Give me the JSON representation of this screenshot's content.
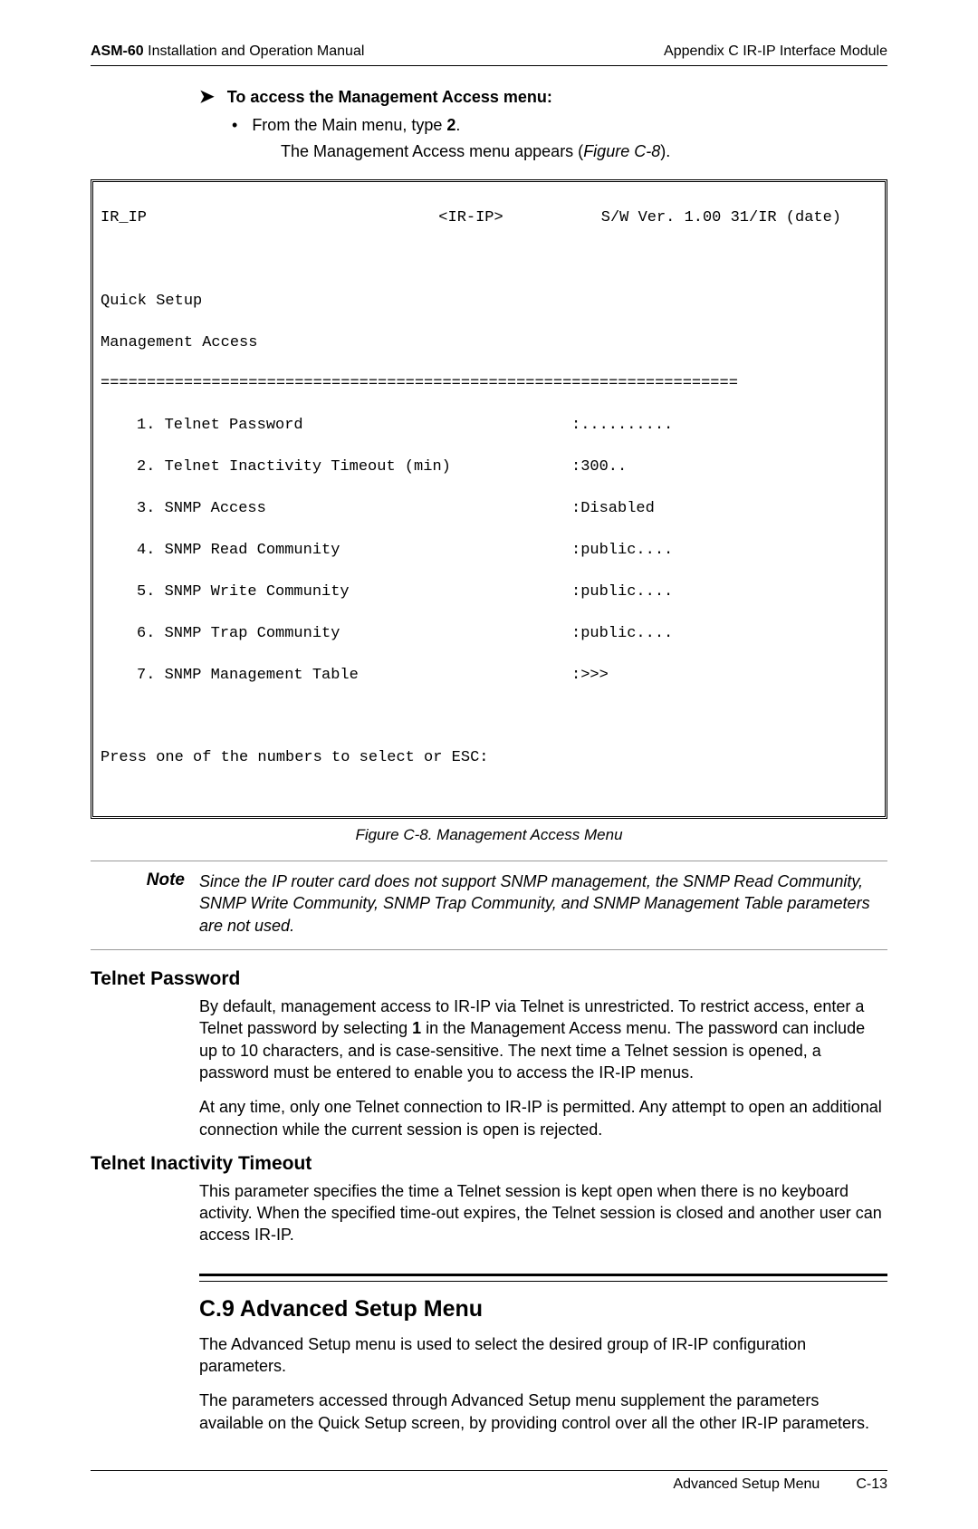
{
  "header": {
    "product": "ASM-60",
    "manual": "Installation and Operation Manual",
    "appendix": "Appendix C  IR-IP Interface Module"
  },
  "proc": {
    "title": "To access the Management Access menu:",
    "bullet_prefix": "From the Main menu, type ",
    "bullet_bold": "2",
    "bullet_suffix": ".",
    "result_prefix": "The Management Access menu appears (",
    "result_ref": "Figure C-8",
    "result_suffix": ")."
  },
  "terminal": {
    "hdr_left": "IR_IP",
    "hdr_center": "<IR-IP>",
    "hdr_right": "S/W Ver. 1.00 31/IR (date)",
    "line1": "Quick Setup",
    "line2": "Management Access",
    "divider": "=====================================================================",
    "rows": [
      {
        "label": "1. Telnet Password",
        "val": ":.........."
      },
      {
        "label": "2. Telnet Inactivity Timeout (min)",
        "val": ":300.."
      },
      {
        "label": "3. SNMP Access",
        "val": ":Disabled"
      },
      {
        "label": "4. SNMP Read Community",
        "val": ":public...."
      },
      {
        "label": "5. SNMP Write Community",
        "val": ":public...."
      },
      {
        "label": "6. SNMP Trap Community",
        "val": ":public...."
      },
      {
        "label": "7. SNMP Management Table",
        "val": ":>>>"
      }
    ],
    "prompt": "Press one of the numbers to select or ESC:"
  },
  "figure_caption": "Figure C-8.  Management Access Menu",
  "note": {
    "label": "Note",
    "text": "Since the IP router card does not support SNMP management, the SNMP Read Community, SNMP Write Community, SNMP Trap Community, and SNMP Management Table parameters are not used."
  },
  "telnet_pw": {
    "heading": "Telnet Password",
    "p1_a": "By default, management access to IR-IP via Telnet is unrestricted. To restrict access, enter a Telnet password by selecting ",
    "p1_bold": "1",
    "p1_b": " in the Management Access menu. The password can include up to 10 characters, and is case-sensitive. The next time a Telnet session is opened, a password must be entered to enable you to access the IR-IP menus.",
    "p2": "At any time, only one Telnet connection to IR-IP is permitted. Any attempt to open an additional connection while the current session is open is rejected."
  },
  "telnet_to": {
    "heading": "Telnet Inactivity Timeout",
    "p1": "This parameter specifies the time a Telnet session is kept open when there is no keyboard activity. When the specified time-out expires, the Telnet session is closed and another user can access IR-IP."
  },
  "adv": {
    "heading": "C.9 Advanced Setup Menu",
    "p1": "The Advanced Setup menu is used to select the desired group of IR-IP configuration parameters.",
    "p2": "The parameters accessed through Advanced Setup menu supplement the parameters available on the Quick Setup screen, by providing control over all the other IR-IP parameters."
  },
  "footer": {
    "section": "Advanced Setup Menu",
    "page": "C-13"
  }
}
